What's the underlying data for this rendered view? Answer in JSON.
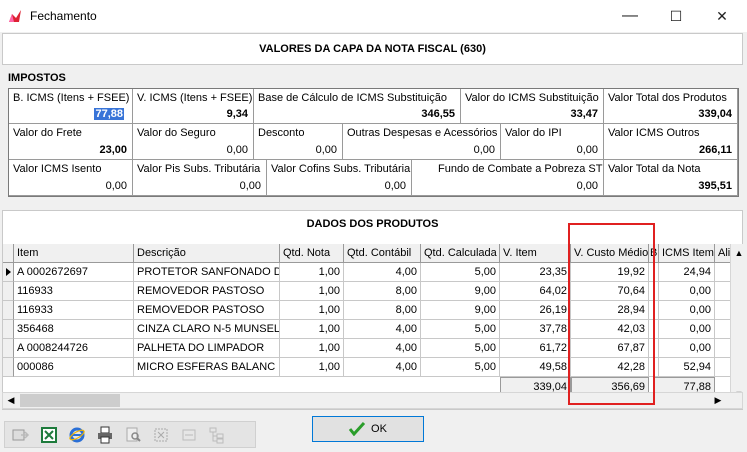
{
  "window": {
    "title": "Fechamento",
    "min_glyph": "—",
    "max_glyph": "☐",
    "close_glyph": "✕"
  },
  "banner": "VALORES DA CAPA DA NOTA FISCAL (630)",
  "taxes": {
    "section": "IMPOSTOS",
    "b_icms": {
      "label": "B. ICMS (Itens + FSEE)",
      "value": "77,88"
    },
    "v_icms": {
      "label": "V. ICMS (Itens + FSEE)",
      "value": "9,34"
    },
    "base_icms_st": {
      "label": "Base de Cálculo de ICMS Substituição",
      "value": "346,55"
    },
    "valor_icms_st": {
      "label": "Valor do ICMS Substituição",
      "value": "33,47"
    },
    "total_produtos": {
      "label": "Valor Total dos Produtos",
      "value": "339,04"
    },
    "frete": {
      "label": "Valor do Frete",
      "value": "23,00"
    },
    "seguro": {
      "label": "Valor do Seguro",
      "value": "0,00"
    },
    "desconto": {
      "label": "Desconto",
      "value": "0,00"
    },
    "outras": {
      "label": "Outras Despesas e Acessórios",
      "value": "0,00"
    },
    "ipi": {
      "label": "Valor do IPI",
      "value": "0,00"
    },
    "icms_outros": {
      "label": "Valor ICMS Outros",
      "value": "266,11"
    },
    "icms_isento": {
      "label": "Valor ICMS Isento",
      "value": "0,00"
    },
    "pis_st": {
      "label": "Valor Pis Subs. Tributária",
      "value": "0,00"
    },
    "cofins_st": {
      "label": "Valor Cofins Subs. Tributária",
      "value": "0,00"
    },
    "fcp_st": {
      "label": "Fundo de Combate a Pobreza ST",
      "value": "0,00"
    },
    "total_nota": {
      "label": "Valor Total da Nota",
      "value": "395,51"
    }
  },
  "products": {
    "section": "DADOS DOS PRODUTOS",
    "columns": [
      "Item",
      "Descrição",
      "Qtd. Nota",
      "Qtd. Contábil",
      "Qtd. Calculada",
      "V. Item",
      "V. Custo Médio",
      "B",
      "ICMS Item",
      "Ali"
    ],
    "rows": [
      {
        "item": "A 0002672697",
        "desc": "PROTETOR SANFONADO DE E",
        "qtd_nota": "1,00",
        "qtd_contabil": "4,00",
        "qtd_calc": "5,00",
        "v_item": "23,35",
        "v_custo": "19,92",
        "icms": "24,94"
      },
      {
        "item": "116933",
        "desc": "REMOVEDOR PASTOSO",
        "qtd_nota": "1,00",
        "qtd_contabil": "8,00",
        "qtd_calc": "9,00",
        "v_item": "64,02",
        "v_custo": "70,64",
        "icms": "0,00"
      },
      {
        "item": "116933",
        "desc": "REMOVEDOR PASTOSO",
        "qtd_nota": "1,00",
        "qtd_contabil": "8,00",
        "qtd_calc": "9,00",
        "v_item": "26,19",
        "v_custo": "28,94",
        "icms": "0,00"
      },
      {
        "item": "356468",
        "desc": "CINZA CLARO N-5 MUNSELL L",
        "qtd_nota": "1,00",
        "qtd_contabil": "4,00",
        "qtd_calc": "5,00",
        "v_item": "37,78",
        "v_custo": "42,03",
        "icms": "0,00"
      },
      {
        "item": "A 0008244726",
        "desc": "PALHETA DO LIMPADOR",
        "qtd_nota": "1,00",
        "qtd_contabil": "4,00",
        "qtd_calc": "5,00",
        "v_item": "61,72",
        "v_custo": "67,87",
        "icms": "0,00"
      },
      {
        "item": "000086",
        "desc": "MICRO ESFERAS BALANC PNE",
        "qtd_nota": "1,00",
        "qtd_contabil": "4,00",
        "qtd_calc": "5,00",
        "v_item": "49,58",
        "v_custo": "42,28",
        "icms": "52,94"
      }
    ],
    "totals": {
      "v_item": "339,04",
      "v_custo": "356,69",
      "icms": "77,88"
    }
  },
  "toolbar_icons": [
    "export-icon",
    "excel-icon",
    "ie-icon",
    "print-icon",
    "print-preview-icon",
    "filter-icon",
    "collapse-icon",
    "tree-icon"
  ],
  "ok_label": "OK",
  "colors": {
    "highlight": "#e02020",
    "selection": "#3874d8",
    "ok_check": "#2a9d2a"
  }
}
